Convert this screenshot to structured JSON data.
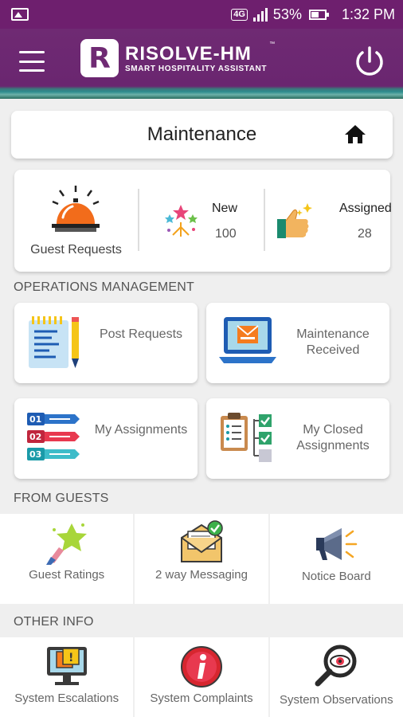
{
  "status_bar": {
    "network": "4G",
    "battery": "53%",
    "time": "1:32 PM"
  },
  "header": {
    "logo_mark": "R",
    "logo_title": "RISOLVE-HM",
    "logo_subtitle": "SMART HOSPITALITY ASSISTANT",
    "trademark": "™"
  },
  "page": {
    "title": "Maintenance"
  },
  "stats": {
    "guest_requests_label": "Guest Requests",
    "new_label": "New",
    "new_value": "100",
    "assigned_label": "Assigned",
    "assigned_value": "28"
  },
  "operations": {
    "heading": "OPERATIONS MANAGEMENT",
    "items": [
      {
        "label": "Post Requests",
        "icon": "notepad-pencil-icon"
      },
      {
        "label": "Maintenance Received",
        "icon": "laptop-mail-icon"
      },
      {
        "label": "My Assignments",
        "icon": "numbered-list-icon"
      },
      {
        "label": "My Closed Assignments",
        "icon": "checklist-clipboard-icon"
      }
    ]
  },
  "from_guests": {
    "heading": "FROM GUESTS",
    "items": [
      {
        "label": "Guest Ratings",
        "icon": "star-rating-icon"
      },
      {
        "label": "2 way Messaging",
        "icon": "envelope-check-icon"
      },
      {
        "label": "Notice Board",
        "icon": "megaphone-icon"
      }
    ]
  },
  "other_info": {
    "heading": "OTHER INFO",
    "items": [
      {
        "label": "System Escalations",
        "icon": "monitor-alert-icon"
      },
      {
        "label": "System Complaints",
        "icon": "info-icon"
      },
      {
        "label": "System Observations",
        "icon": "magnifier-eye-icon"
      }
    ]
  },
  "colors": {
    "brand_purple": "#6f2a73",
    "card_bg": "#ffffff",
    "page_bg": "#efefef"
  }
}
